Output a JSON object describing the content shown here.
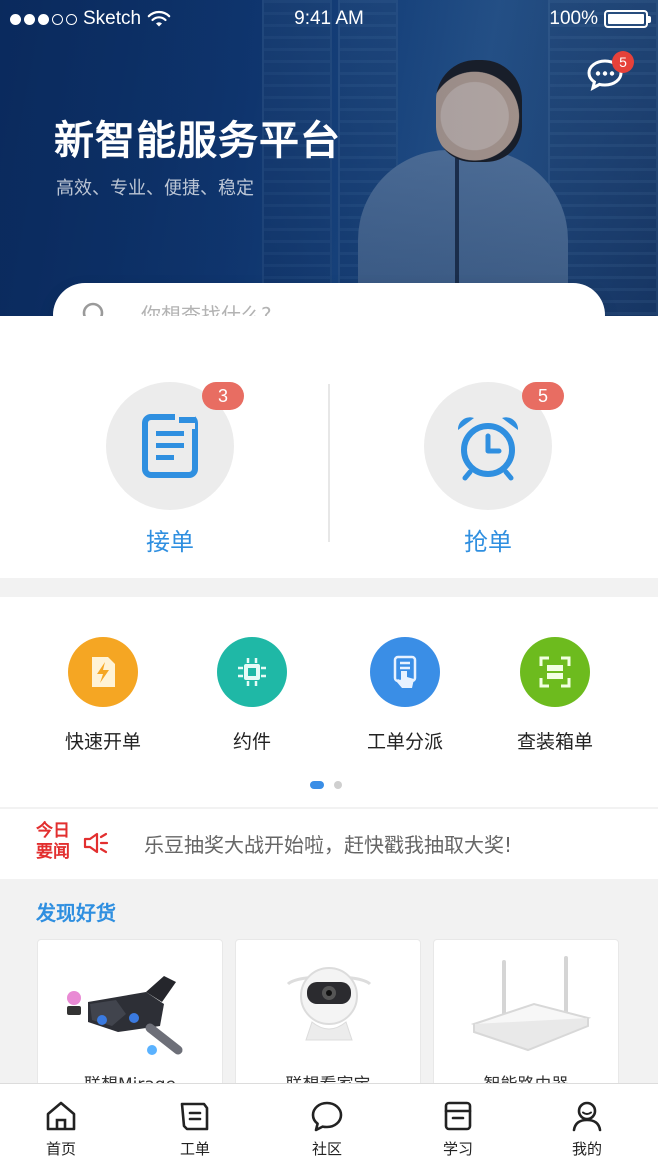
{
  "status_bar": {
    "carrier": "Sketch",
    "time": "9:41 AM",
    "battery": "100%"
  },
  "header": {
    "title": "新智能服务平台",
    "subtitle": "高效、专业、便捷、稳定",
    "message_badge": "5"
  },
  "search": {
    "placeholder": "你想查找什么?"
  },
  "orders": [
    {
      "label": "接单",
      "badge": "3",
      "icon": "document-icon"
    },
    {
      "label": "抢单",
      "badge": "5",
      "icon": "alarm-clock-icon"
    }
  ],
  "quick_actions": [
    {
      "label": "快速开单",
      "icon": "lightning-card-icon",
      "color": "#f5a623"
    },
    {
      "label": "约件",
      "icon": "chip-icon",
      "color": "#1fb8a6"
    },
    {
      "label": "工单分派",
      "icon": "hand-document-icon",
      "color": "#3a8ee6"
    },
    {
      "label": "查装箱单",
      "icon": "scan-frame-icon",
      "color": "#6dbb1e"
    }
  ],
  "news": {
    "tag": "今日要闻",
    "text": "乐豆抽奖大战开始啦，赶快戳我抽取大奖!"
  },
  "goods": {
    "title": "发现好货",
    "items": [
      {
        "name": "联想Mirage"
      },
      {
        "name": "联想看家宝"
      },
      {
        "name": "智能路由器"
      }
    ]
  },
  "tabs": [
    {
      "label": "首页",
      "icon": "home-icon"
    },
    {
      "label": "工单",
      "icon": "work-order-icon"
    },
    {
      "label": "社区",
      "icon": "chat-icon"
    },
    {
      "label": "学习",
      "icon": "book-icon"
    },
    {
      "label": "我的",
      "icon": "profile-icon"
    }
  ]
}
